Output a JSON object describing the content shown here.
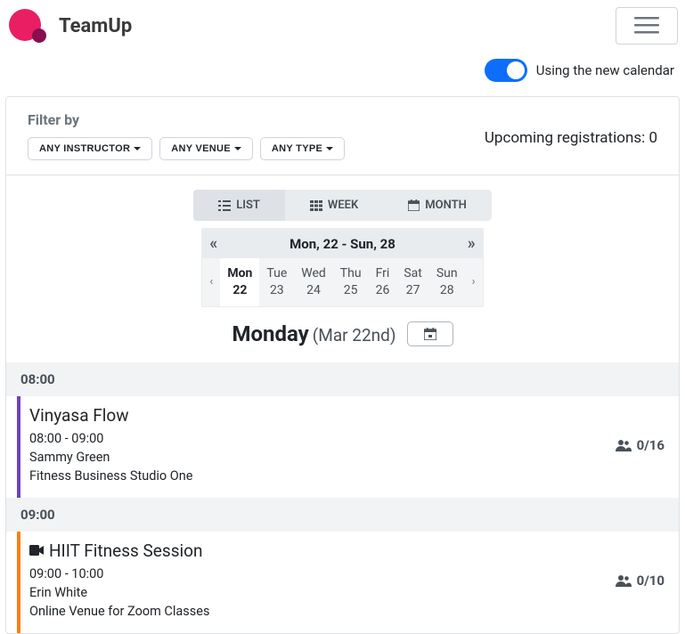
{
  "brand": {
    "name": "TeamUp"
  },
  "toggle": {
    "label": "Using the new calendar",
    "on": true
  },
  "filter": {
    "title": "Filter by",
    "instructor_label": "ANY INSTRUCTOR",
    "venue_label": "ANY VENUE",
    "type_label": "ANY TYPE"
  },
  "upcoming": {
    "text": "Upcoming registrations: 0"
  },
  "views": {
    "list": "LIST",
    "week": "WEEK",
    "month": "MONTH"
  },
  "week": {
    "range": "Mon, 22 - Sun, 28",
    "days": [
      {
        "label": "Mon",
        "num": "22",
        "active": true
      },
      {
        "label": "Tue",
        "num": "23",
        "active": false
      },
      {
        "label": "Wed",
        "num": "24",
        "active": false
      },
      {
        "label": "Thu",
        "num": "25",
        "active": false
      },
      {
        "label": "Fri",
        "num": "26",
        "active": false
      },
      {
        "label": "Sat",
        "num": "27",
        "active": false
      },
      {
        "label": "Sun",
        "num": "28",
        "active": false
      }
    ]
  },
  "date_title": {
    "main": "Monday",
    "sub": "(Mar 22nd)"
  },
  "timeblocks": [
    {
      "time": "08:00",
      "events": [
        {
          "title": "Vinyasa Flow",
          "time_range": "08:00 - 09:00",
          "instructor": "Sammy Green",
          "venue": "Fitness Business Studio One",
          "capacity": "0/16",
          "color": "purple",
          "video": false
        }
      ]
    },
    {
      "time": "09:00",
      "events": [
        {
          "title": "HIIT Fitness Session",
          "time_range": "09:00 - 10:00",
          "instructor": "Erin White",
          "venue": "Online Venue for Zoom Classes",
          "capacity": "0/10",
          "color": "orange",
          "video": true
        }
      ]
    }
  ]
}
